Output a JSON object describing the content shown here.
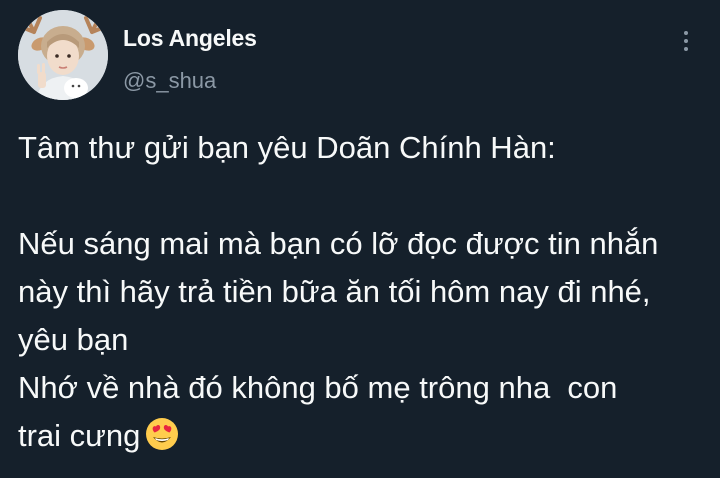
{
  "author": {
    "display_name": "Los Angeles",
    "handle": "@s_shua",
    "avatar_icon": "profile-photo"
  },
  "menu": {
    "icon": "more-vertical-icon"
  },
  "post": {
    "lines": [
      "Tâm thư gửi bạn yêu Doãn Chính Hàn:",
      "",
      "Nếu sáng mai mà bạn có lỡ đọc được tin nhắn",
      "này thì hãy trả tiền bữa ăn tối hôm nay đi nhé,",
      "yêu bạn",
      "Nhớ về nhà đó không bố mẹ trông nha  con",
      "trai cưng"
    ],
    "trailing_emoji": "heart-eyes-emoji-icon"
  },
  "colors": {
    "background": "#15202b",
    "text": "#f7f9f9",
    "secondary_text": "#8b98a5"
  }
}
